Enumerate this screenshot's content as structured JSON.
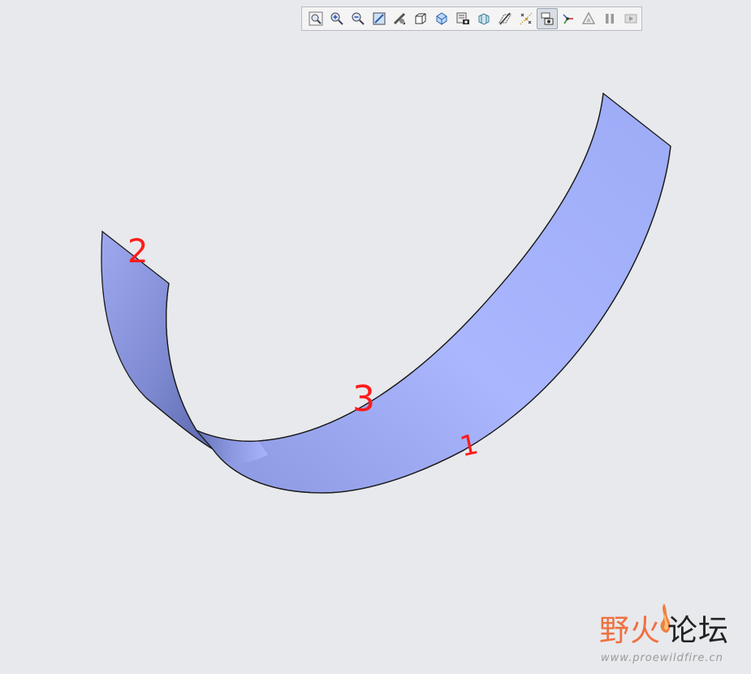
{
  "toolbar": {
    "buttons": [
      {
        "name": "zoom-to-fit-icon",
        "active": false
      },
      {
        "name": "zoom-in-icon",
        "active": false
      },
      {
        "name": "zoom-out-icon",
        "active": false
      },
      {
        "name": "repaint-icon",
        "active": false
      },
      {
        "name": "perspective-view-icon",
        "active": false
      },
      {
        "name": "display-style-icon",
        "active": false
      },
      {
        "name": "saved-orientations-icon",
        "active": false
      },
      {
        "name": "view-manager-icon",
        "active": false
      },
      {
        "name": "section-view-icon",
        "active": false
      },
      {
        "name": "datum-display-filter-icon",
        "active": false
      },
      {
        "name": "datum-points-icon",
        "active": false
      },
      {
        "name": "annotation-display-icon",
        "active": true
      },
      {
        "name": "spin-center-icon",
        "active": false
      },
      {
        "name": "simulation-display-icon",
        "active": false
      },
      {
        "name": "pause-icon",
        "active": false
      },
      {
        "name": "next-icon",
        "active": false
      }
    ]
  },
  "markers": {
    "edge_1": "1",
    "edge_2": "2",
    "edge_3": "3"
  },
  "watermark": {
    "text_fire": "野火",
    "text_forum": "论坛",
    "url": "www.proewildfire.cn"
  },
  "colors": {
    "background": "#e8e9ec",
    "surface_light": "#b0bcff",
    "surface_dark": "#6a78c4",
    "marker": "#ff1a1a",
    "watermark_fire": "#f07040"
  }
}
